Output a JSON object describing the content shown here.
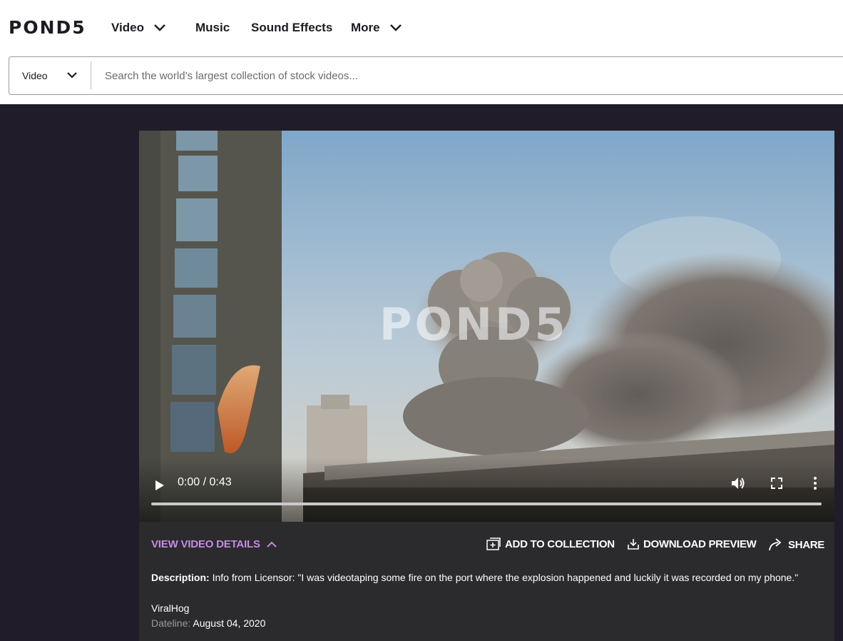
{
  "header": {
    "logo": "POND5",
    "nav": [
      {
        "label": "Video",
        "has_dropdown": true
      },
      {
        "label": "Music",
        "has_dropdown": false
      },
      {
        "label": "Sound Effects",
        "has_dropdown": false
      },
      {
        "label": "More",
        "has_dropdown": true
      }
    ]
  },
  "search": {
    "type_selected": "Video",
    "placeholder": "Search the world’s largest collection of stock videos..."
  },
  "player": {
    "watermark": "POND5",
    "time": "0:00 / 0:43",
    "progress": 0
  },
  "details": {
    "view_details_label": "VIEW VIDEO DETAILS",
    "actions": {
      "add_to_collection": "ADD TO COLLECTION",
      "download_preview": "DOWNLOAD PREVIEW",
      "share": "SHARE"
    },
    "description_label": "Description:",
    "description_text": " Info from Licensor: \"I was videotaping some fire on the port where the explosion happened and luckily it was recorded on my phone.\"",
    "author": "ViralHog",
    "dateline_label": "Dateline:",
    "dateline_value": "August 04, 2020"
  },
  "colors": {
    "page_dark": "#211c29",
    "details_panel": "#2b2a2d",
    "accent_purple": "#c48be6"
  }
}
